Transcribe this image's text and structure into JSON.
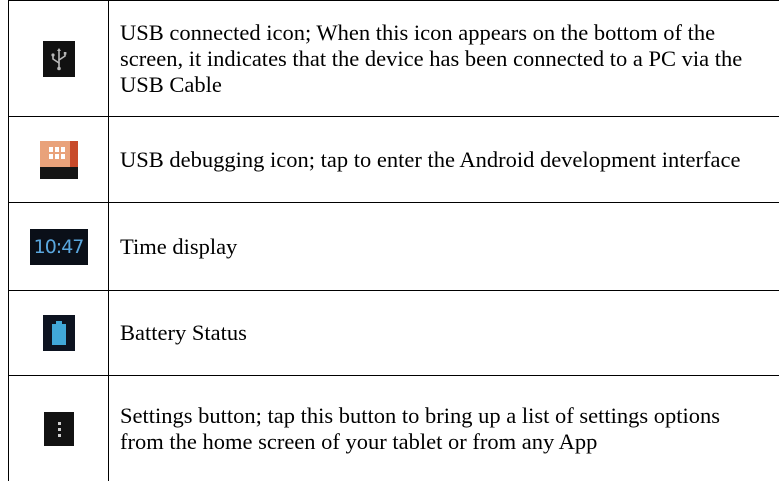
{
  "colors": {
    "border": "#000000",
    "time_icon_text": "#5aa7de",
    "battery_fill": "#41a8d8",
    "debug_icon_orange": "#e9a27a",
    "debug_icon_red": "#c84a2a"
  },
  "rows": [
    {
      "icon": "usb-connected-icon",
      "description": "USB connected icon; When this icon appears on the bottom of the screen, it indicates that the device has been connected to a PC via the USB Cable"
    },
    {
      "icon": "usb-debugging-icon",
      "description": "USB debugging icon; tap to enter the Android development interface"
    },
    {
      "icon": "time-display-icon",
      "icon_text": "10:47",
      "description": "Time display"
    },
    {
      "icon": "battery-icon",
      "description": "Battery Status"
    },
    {
      "icon": "settings-menu-icon",
      "description": "Settings button; tap this button to bring up a list of settings options from the home screen of your tablet or from any App"
    }
  ]
}
